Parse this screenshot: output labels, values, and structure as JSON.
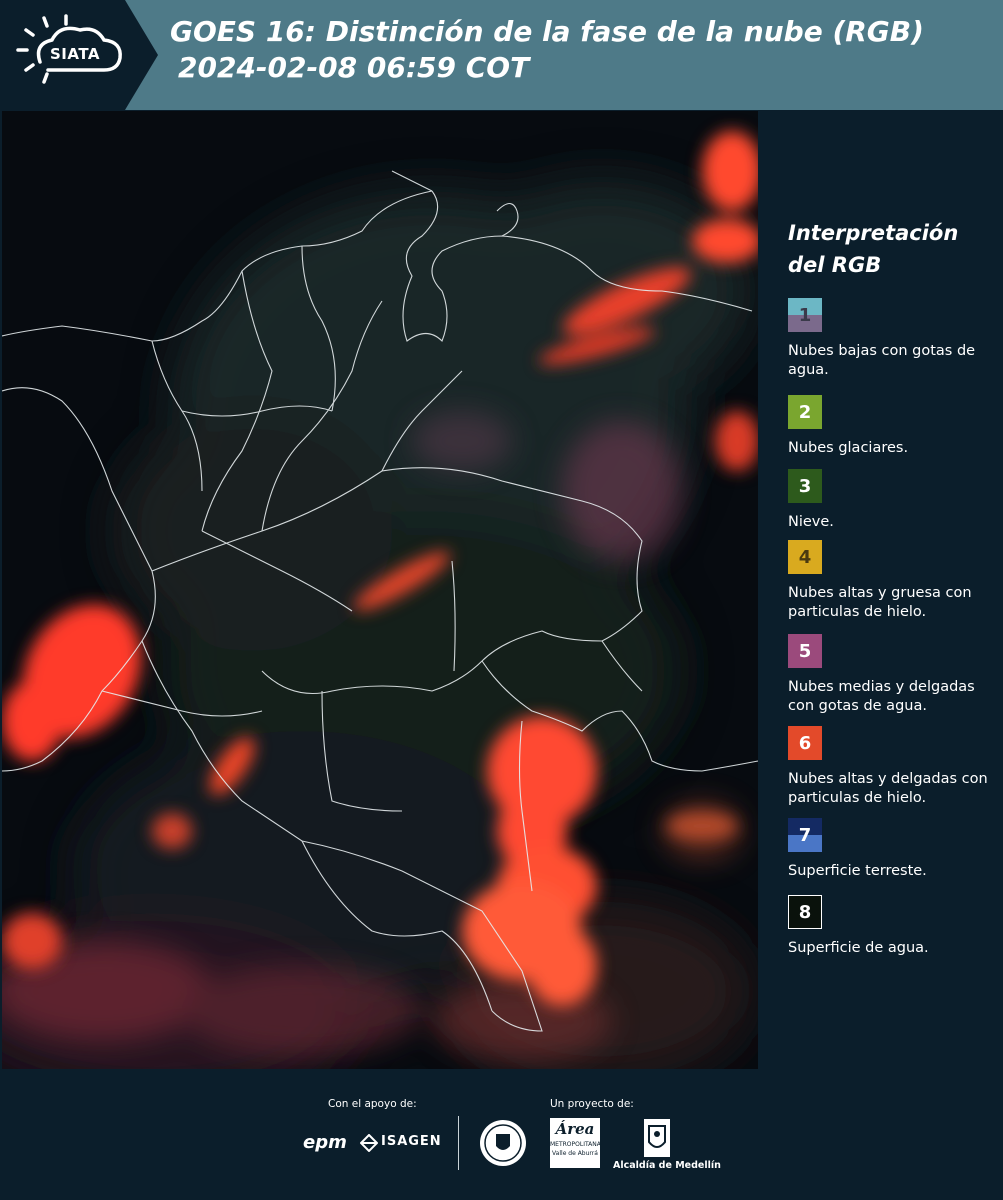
{
  "header": {
    "logo_text": "SIATA",
    "title_line1": "GOES 16: Distinción de la fase de la nube (RGB)",
    "title_line2": "2024-02-08 06:59 COT"
  },
  "legend": {
    "title": "Interpretación del RGB",
    "items": [
      {
        "number": "1",
        "label": "Nubes bajas con gotas de agua.",
        "color_top": "#6cb7c5",
        "color_bottom": "#7b6a8c"
      },
      {
        "number": "2",
        "label": "Nubes glaciares.",
        "color": "#7aa62f"
      },
      {
        "number": "3",
        "label": "Nieve.",
        "color": "#2d5a1c"
      },
      {
        "number": "4",
        "label": "Nubes altas y gruesa con particulas de hielo.",
        "color": "#d9aa1f"
      },
      {
        "number": "5",
        "label": "Nubes medias y delgadas con gotas de agua.",
        "color": "#9b4a7c"
      },
      {
        "number": "6",
        "label": "Nubes altas y delgadas con particulas de hielo.",
        "color": "#e34a2a"
      },
      {
        "number": "7",
        "label": "Superficie terreste.",
        "color_top": "#142a63",
        "color_bottom": "#4a76c6"
      },
      {
        "number": "8",
        "label": "Superficie de agua.",
        "color": "#0a120c"
      }
    ]
  },
  "footer": {
    "support_label": "Con el apoyo de:",
    "project_label": "Un proyecto de:",
    "sponsor_epm": "epm",
    "sponsor_isagen": "ISAGEN",
    "metro_top": "Área",
    "metro_mid": "METROPOLITANA",
    "metro_bottom": "Valle de Aburrá",
    "alcaldia": "Alcaldía de Medellín"
  },
  "colors": {
    "header_bg": "#4e7a88",
    "page_bg": "#0b1e2b",
    "cloud_red": "#ff4a2e"
  }
}
